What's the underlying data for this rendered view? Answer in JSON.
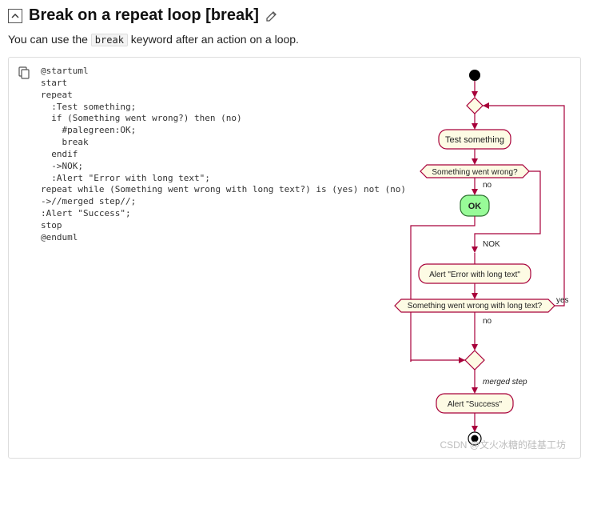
{
  "header": {
    "title": "Break on a repeat loop [break]"
  },
  "intro": {
    "prefix": "You can use the ",
    "keyword": "break",
    "suffix": " keyword after an action on a loop."
  },
  "code": "@startuml\nstart\nrepeat\n  :Test something;\n  if (Something went wrong?) then (no)\n    #palegreen:OK;\n    break\n  endif\n  ->NOK;\n  :Alert \"Error with long text\";\nrepeat while (Something went wrong with long text?) is (yes) not (no)\n->//merged step//;\n:Alert \"Success\";\nstop\n@enduml",
  "diagram": {
    "nodes": {
      "n1": "Test something",
      "n2": "Something went wrong?",
      "ok": "OK",
      "n3": "Alert \"Error with long text\"",
      "n4": "Something went wrong with long text?",
      "n5": "Alert \"Success\""
    },
    "labels": {
      "no1": "no",
      "nok": "NOK",
      "no2": "no",
      "yes": "yes",
      "merged": "merged step"
    }
  },
  "watermark": "CSDN @文火冰糖的硅基工坊"
}
